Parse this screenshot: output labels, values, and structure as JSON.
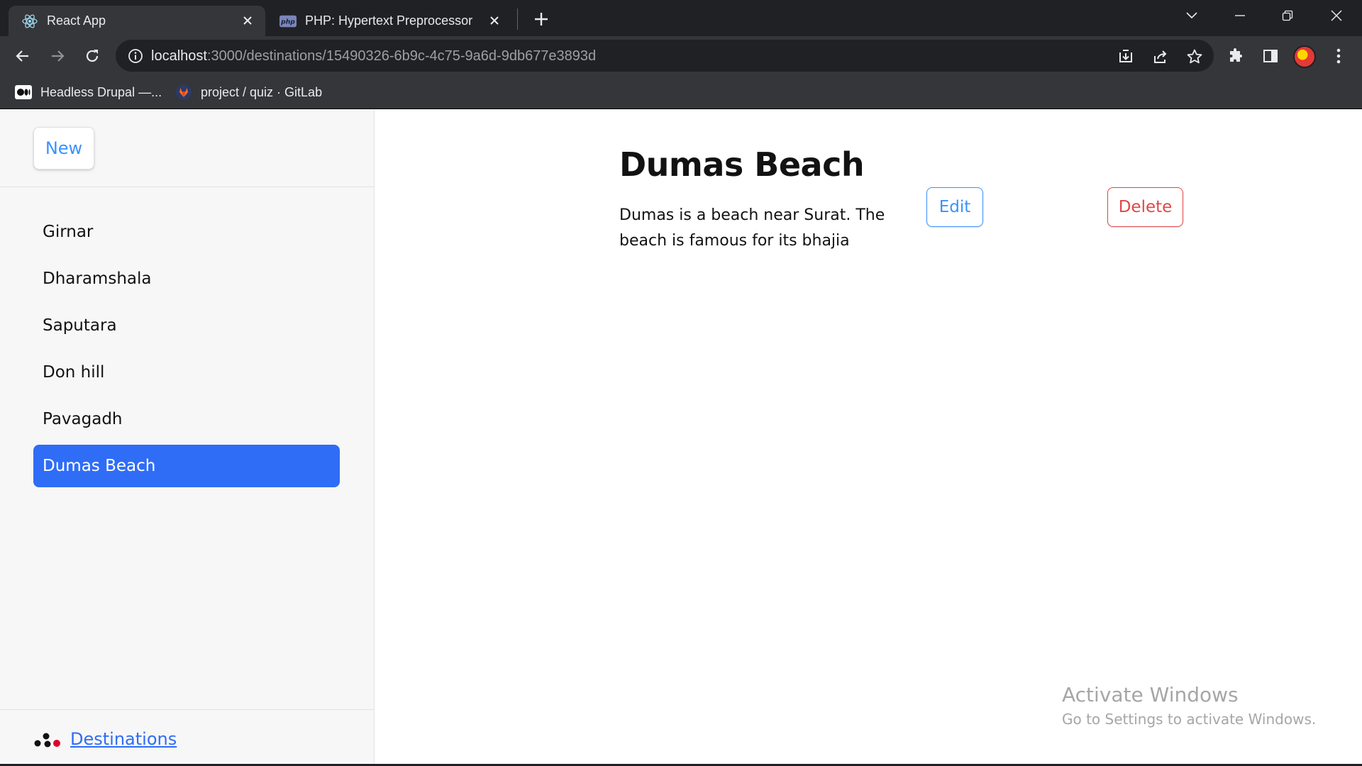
{
  "browser": {
    "tabs": [
      {
        "title": "React App",
        "icon": "react-icon",
        "active": true
      },
      {
        "title": "PHP: Hypertext Preprocessor",
        "icon": "php-icon",
        "active": false
      }
    ],
    "url": {
      "host": "localhost",
      "path": ":3000/destinations/15490326-6b9c-4c75-9a6d-9db677e3893d"
    },
    "bookmarks": [
      {
        "label": "Headless Drupal —...",
        "icon": "medium-icon"
      },
      {
        "label": "project / quiz · GitLab",
        "icon": "gitlab-icon"
      }
    ],
    "php_favicon_text": "php"
  },
  "sidebar": {
    "new_label": "New",
    "items": [
      {
        "label": "Girnar",
        "active": false
      },
      {
        "label": "Dharamshala",
        "active": false
      },
      {
        "label": "Saputara",
        "active": false
      },
      {
        "label": "Don hill",
        "active": false
      },
      {
        "label": "Pavagadh",
        "active": false
      },
      {
        "label": "Dumas Beach",
        "active": true
      }
    ],
    "footer_link": "Destinations"
  },
  "detail": {
    "title": "Dumas Beach",
    "description": "Dumas is a beach near Surat. The beach is famous for its bhajia",
    "edit_label": "Edit",
    "delete_label": "Delete"
  },
  "watermark": {
    "line1": "Activate Windows",
    "line2": "Go to Settings to activate Windows."
  },
  "colors": {
    "accent": "#3992ff",
    "active_item": "#2f6df6",
    "danger": "#e04848"
  }
}
